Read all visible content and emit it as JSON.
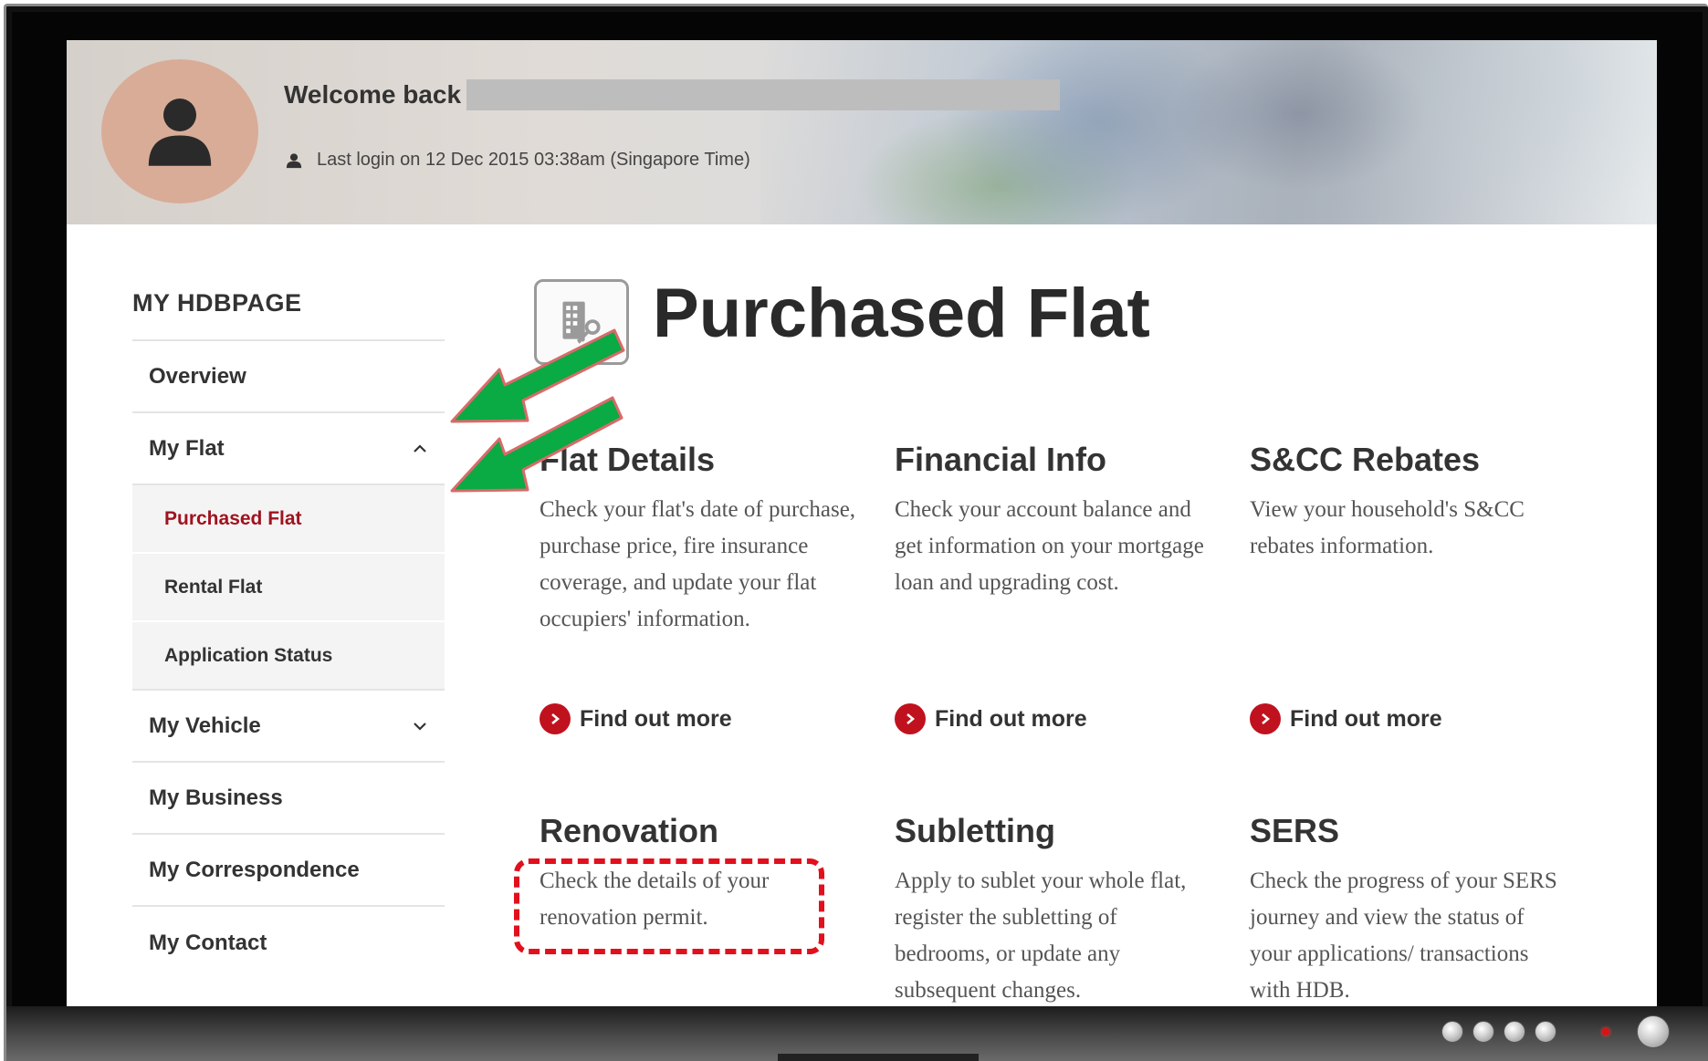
{
  "header": {
    "welcome_text": "Welcome back",
    "last_login": "Last login on 12 Dec 2015 03:38am (Singapore Time)"
  },
  "sidebar": {
    "title": "MY HDBPAGE",
    "items": [
      {
        "label": "Overview"
      },
      {
        "label": "My Flat",
        "expanded": true,
        "icon": "chevron-up-icon"
      },
      {
        "label": "Purchased Flat",
        "sub": true,
        "active": true
      },
      {
        "label": "Rental Flat",
        "sub": true
      },
      {
        "label": "Application Status",
        "sub": true
      },
      {
        "label": "My Vehicle",
        "icon": "chevron-down-icon"
      },
      {
        "label": "My Business"
      },
      {
        "label": "My Correspondence"
      },
      {
        "label": "My Contact"
      }
    ]
  },
  "main": {
    "title": "Purchased Flat",
    "page_icon": "building-key-icon",
    "cards": [
      {
        "title": "Flat Details",
        "description": "Check your flat's date of purchase, purchase price, fire insurance coverage, and update your flat occupiers' information.",
        "link": "Find out more"
      },
      {
        "title": "Financial Info",
        "description": "Check your account balance and get information on your mortgage loan and upgrading cost.",
        "link": "Find out more"
      },
      {
        "title": "S&CC Rebates",
        "description": "View your household's S&CC rebates information.",
        "link": "Find out more"
      },
      {
        "title": "Renovation",
        "description": "Check the details of your renovation permit."
      },
      {
        "title": "Subletting",
        "description": "Apply to sublet your whole flat, register the subletting of bedrooms, or update any subsequent changes."
      },
      {
        "title": "SERS",
        "description": "Check the progress of your SERS journey and view the status of your applications/ transactions with HDB."
      }
    ]
  },
  "colors": {
    "accent_red": "#c0121e",
    "active_nav": "#a0121f",
    "annotation_arrow": "#0aaa44",
    "annotation_box": "#e20f1c"
  }
}
